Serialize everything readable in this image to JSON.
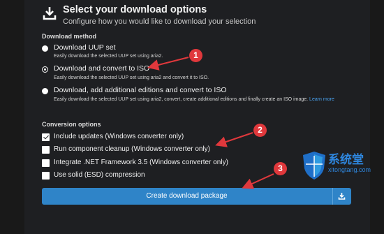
{
  "header": {
    "title": "Select your download options",
    "subtitle": "Configure how you would like to download your selection",
    "icon": "download-icon"
  },
  "download_method": {
    "heading": "Download method",
    "options": [
      {
        "label": "Download UUP set",
        "desc": "Easily download the selected UUP set using aria2.",
        "checked": false
      },
      {
        "label": "Download and convert to ISO",
        "desc": "Easily download the selected UUP set using aria2 and convert it to ISO.",
        "checked": true
      },
      {
        "label": "Download, add additional editions and convert to ISO",
        "desc": "Easily download the selected UUP set using aria2, convert, create additional editions and finally create an ISO image.",
        "link": "Learn more",
        "checked": false
      }
    ]
  },
  "conversion_options": {
    "heading": "Conversion options",
    "items": [
      {
        "label": "Include updates (Windows converter only)",
        "checked": true
      },
      {
        "label": "Run component cleanup (Windows converter only)",
        "checked": false
      },
      {
        "label": "Integrate .NET Framework 3.5 (Windows converter only)",
        "checked": false
      },
      {
        "label": "Use solid (ESD) compression",
        "checked": false
      }
    ]
  },
  "create_button": {
    "label": "Create download package",
    "icon": "download-icon"
  },
  "annotations": {
    "badges": [
      "1",
      "2",
      "3"
    ],
    "color": "#e0383c"
  },
  "watermark": {
    "title": "系统堂",
    "site": "xitongtang.com",
    "icon": "shield-logo-icon"
  },
  "colors": {
    "background": "#1e1f22",
    "accent": "#2f84c8",
    "link": "#4aa3f0"
  }
}
